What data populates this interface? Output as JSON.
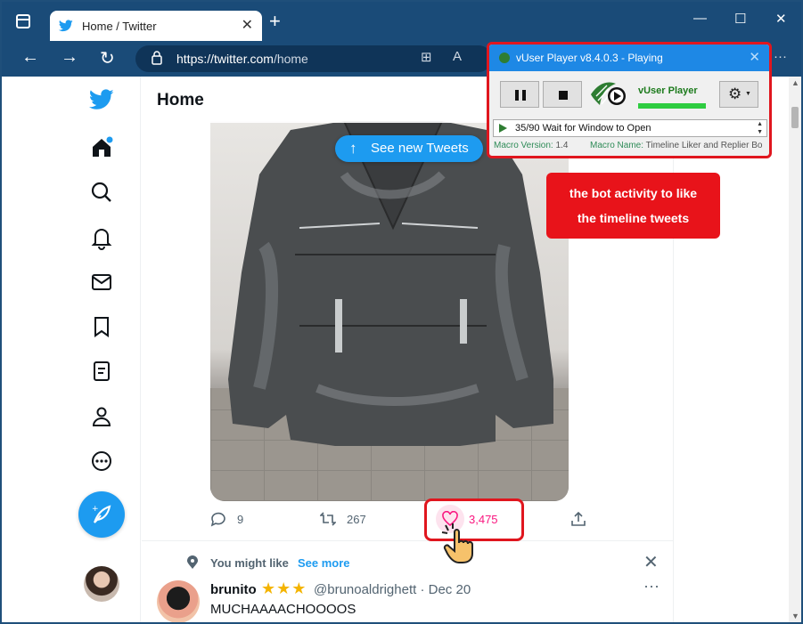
{
  "browser": {
    "tab_title": "Home / Twitter",
    "tab_close": "✕",
    "new_tab": "+",
    "url_host": "https://twitter.com",
    "url_path": "/home",
    "minimize": "—",
    "maximize": "☐",
    "close": "✕",
    "back": "←",
    "forward": "→",
    "reload": "↻",
    "more": "···"
  },
  "twitter": {
    "header_title": "Home",
    "see_new_tweets": "See new Tweets",
    "see_new_arrow": "↑",
    "actions": {
      "replies": "9",
      "retweets": "267",
      "likes": "3,475"
    },
    "you_might_like": "You might like",
    "see_more": "See more",
    "close_glyph": "✕",
    "recommendation": {
      "name": "brunito",
      "stars": "★★★",
      "handle_date": "@brunoaldrighett · Dec 20",
      "more_glyph": "···",
      "text": "MUCHAAAACHOOOOS"
    }
  },
  "vuser_player": {
    "title": "vUser Player v8.4.0.3 - Playing",
    "close_glyph": "✕",
    "brand": "vUser Player",
    "gear_glyph": "⚙",
    "caret_glyph": "▼",
    "status_text": "35/90 Wait for Window to Open",
    "macro_version_label": "Macro Version:",
    "macro_version": "1.4",
    "macro_name_label": "Macro Name:",
    "macro_name": "Timeline Liker and Replier Bo"
  },
  "annotation": {
    "line1": "the bot activity to like",
    "line2": "the timeline tweets"
  },
  "colors": {
    "twitter_blue": "#1d9bf0",
    "browser_chrome": "#1a4b78",
    "like_pink": "#f91880",
    "annotation_red": "#e0161e"
  }
}
